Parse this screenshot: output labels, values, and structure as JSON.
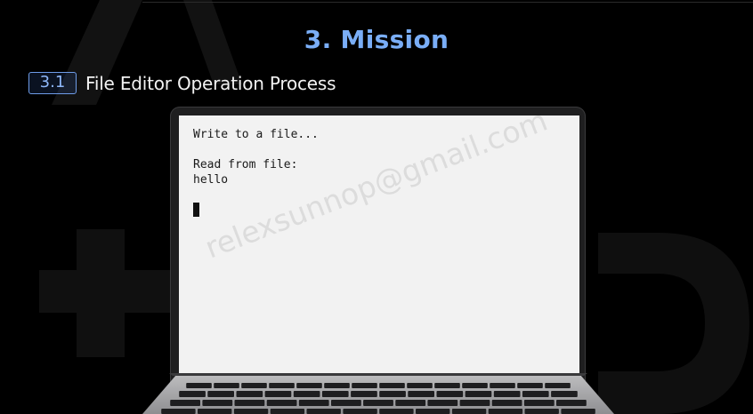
{
  "slide": {
    "title": "3. Mission"
  },
  "section": {
    "number": "3.1",
    "title": "File Editor Operation Process"
  },
  "terminal": {
    "output": "Write to a file...\n\nRead from file:\nhello"
  },
  "watermark": {
    "text": "relexsunnop@gmail.com"
  },
  "colors": {
    "background": "#000000",
    "title_accent": "#7aaef7",
    "badge_border": "#6e9ce8",
    "screen_bg": "#f2f2f2"
  }
}
